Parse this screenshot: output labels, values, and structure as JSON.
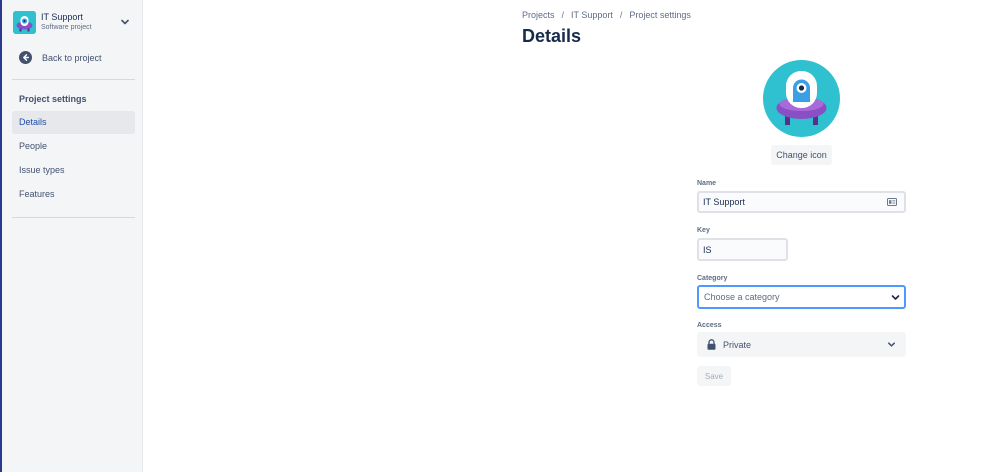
{
  "project": {
    "name": "IT Support",
    "type": "Software project"
  },
  "sidebar": {
    "back_label": "Back to project",
    "section_title": "Project settings",
    "items": [
      {
        "label": "Details",
        "active": true
      },
      {
        "label": "People"
      },
      {
        "label": "Issue types"
      },
      {
        "label": "Features"
      }
    ]
  },
  "breadcrumbs": [
    "Projects",
    "IT Support",
    "Project settings"
  ],
  "breadcrumb_separator": "/",
  "page_title": "Details",
  "form": {
    "change_icon_label": "Change icon",
    "name_label": "Name",
    "name_value": "IT Support",
    "key_label": "Key",
    "key_value": "IS",
    "category_label": "Category",
    "category_placeholder": "Choose a category",
    "access_label": "Access",
    "access_value": "Private",
    "save_label": "Save"
  },
  "colors": {
    "accent": "#1d4ea8",
    "focus_border": "#4c9aff",
    "avatar_bg": "#2fc1d0",
    "ufo_purple": "#8a4fc4",
    "sidebar_bg": "#f4f5f7"
  },
  "icons": [
    "project-avatar-icon",
    "chevron-down-icon",
    "back-arrow-icon",
    "id-card-icon",
    "lock-icon"
  ]
}
